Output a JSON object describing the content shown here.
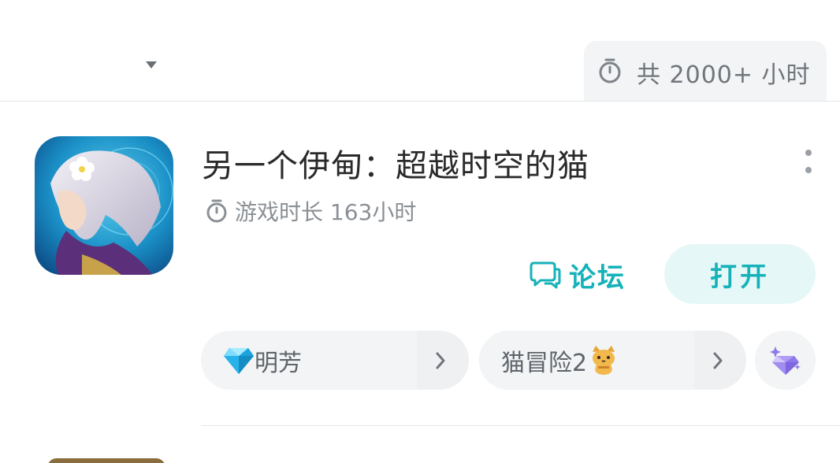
{
  "header": {
    "total_playtime": "共 2000+ 小时",
    "timer_icon": "stopwatch-icon",
    "sort_icon": "caret-down-icon"
  },
  "game": {
    "title": "另一个伊甸：超越时空的猫",
    "playtime": "游戏时长 163小时",
    "forum_label": "论坛",
    "open_label": "打开",
    "more_icon": "more-vertical-icon"
  },
  "tags": [
    {
      "label": "明芳",
      "icon": "diamond-emoji",
      "arrow": "chevron-right-icon"
    },
    {
      "label": "猫冒险2",
      "icon": "cat-emoji",
      "arrow": "chevron-right-icon"
    }
  ],
  "tag_more_icon": "sparkle-gem-icon",
  "colors": {
    "accent": "#16b2b9",
    "accent_bg": "#e6f7f8",
    "chip_bg": "#f2f4f5",
    "text_primary": "#2a2a2a",
    "text_secondary": "#8a9096"
  }
}
